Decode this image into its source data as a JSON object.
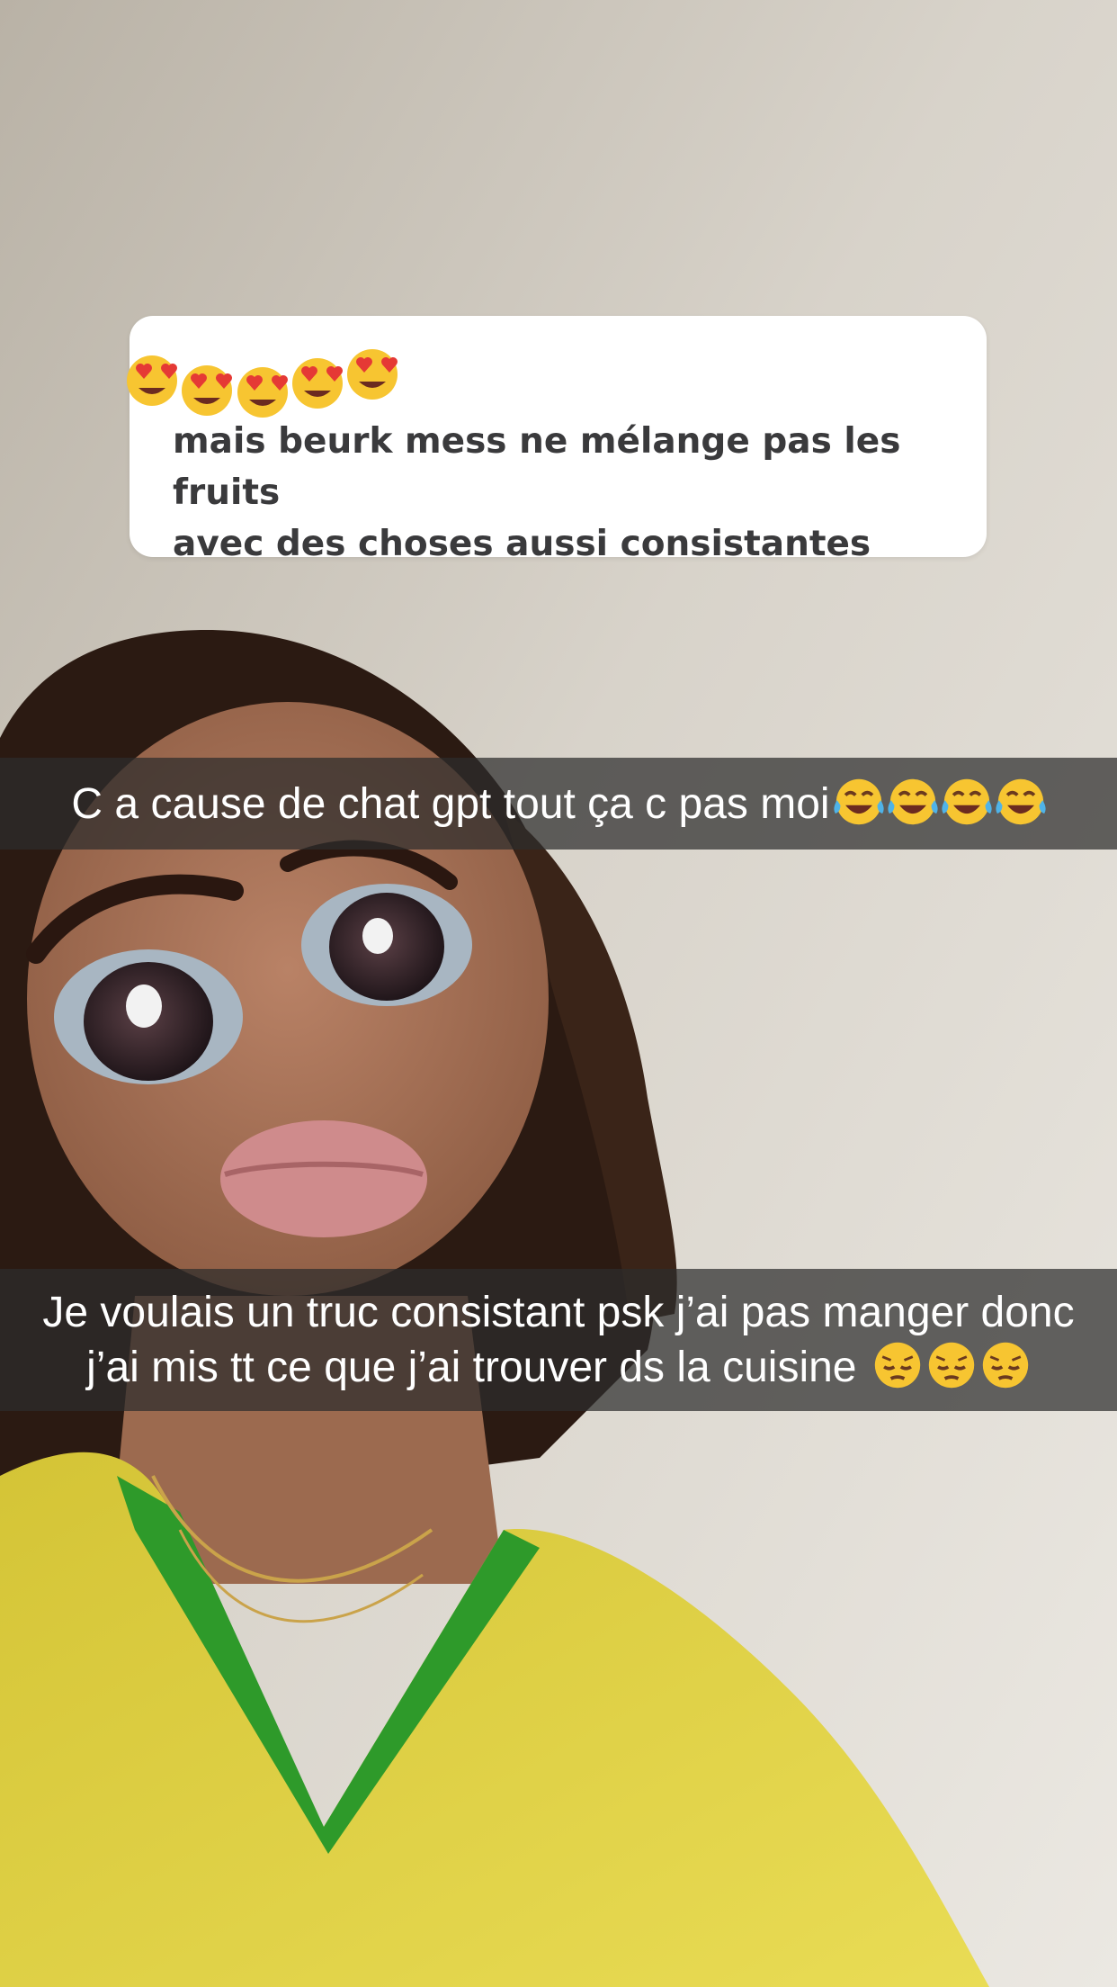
{
  "question_sticker": {
    "text": "mais beurk mess ne mélange pas les fruits\navec des choses aussi consistantes",
    "emojis": [
      "heart-eyes-emoji",
      "heart-eyes-emoji",
      "heart-eyes-emoji",
      "heart-eyes-emoji",
      "heart-eyes-emoji"
    ]
  },
  "caption_1": {
    "text": "C a cause de chat gpt tout ça c pas moi",
    "emojis": [
      "tears-of-joy-emoji",
      "tears-of-joy-emoji",
      "tears-of-joy-emoji",
      "tears-of-joy-emoji"
    ]
  },
  "caption_2": {
    "line1": "Je voulais un truc consistant psk j’ai pas manger donc",
    "line2": "j’ai mis tt ce que j’ai trouver ds la cuisine",
    "emojis": [
      "pensive-emoji",
      "pensive-emoji",
      "pensive-emoji"
    ]
  },
  "colors": {
    "wall": "#dcd8d0",
    "shirt_yellow": "#e6d23c",
    "collar_green": "#2e9a2a",
    "caption_bar": "#2d2d2d",
    "question_text": "#3a3a3c"
  }
}
